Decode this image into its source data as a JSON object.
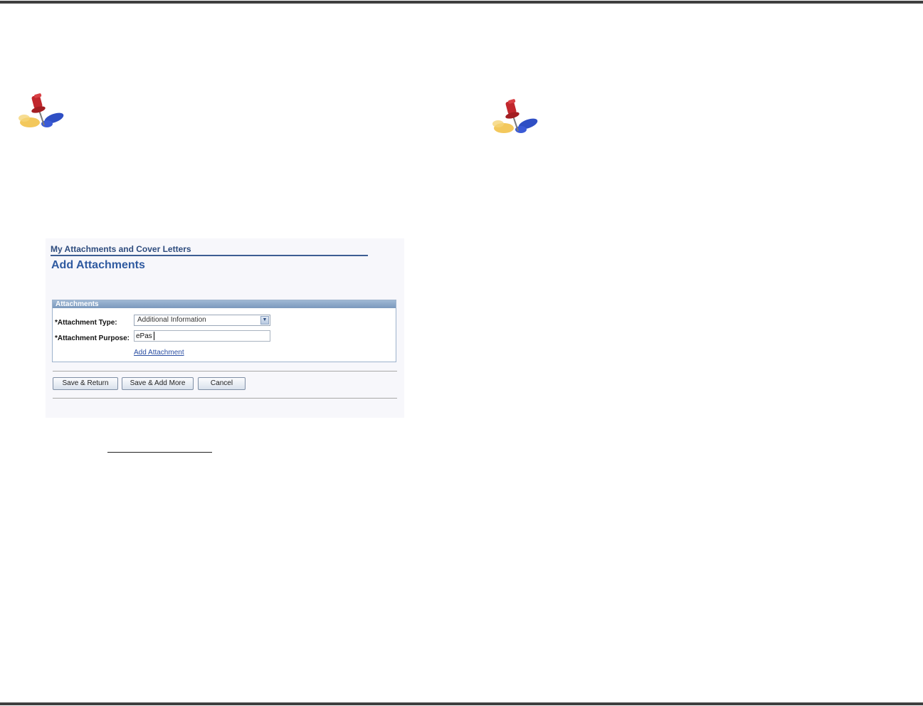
{
  "breadcrumb": "My Attachments and Cover Letters",
  "page_title": "Add Attachments",
  "attachments_group": {
    "header": "Attachments",
    "type_label": "*Attachment Type:",
    "type_value": "Additional Information",
    "purpose_label": "*Attachment Purpose:",
    "purpose_value": "ePas",
    "add_link": "Add Attachment"
  },
  "buttons": {
    "save_return": "Save & Return",
    "save_add_more": "Save & Add More",
    "cancel": "Cancel"
  },
  "icons": {
    "pin": "pushpin-icon",
    "dropdown": "chevron-down-icon"
  },
  "colors": {
    "heading_blue": "#2f5aa0",
    "group_header": "#8aa6c6",
    "link_blue": "#2b4fa3"
  }
}
